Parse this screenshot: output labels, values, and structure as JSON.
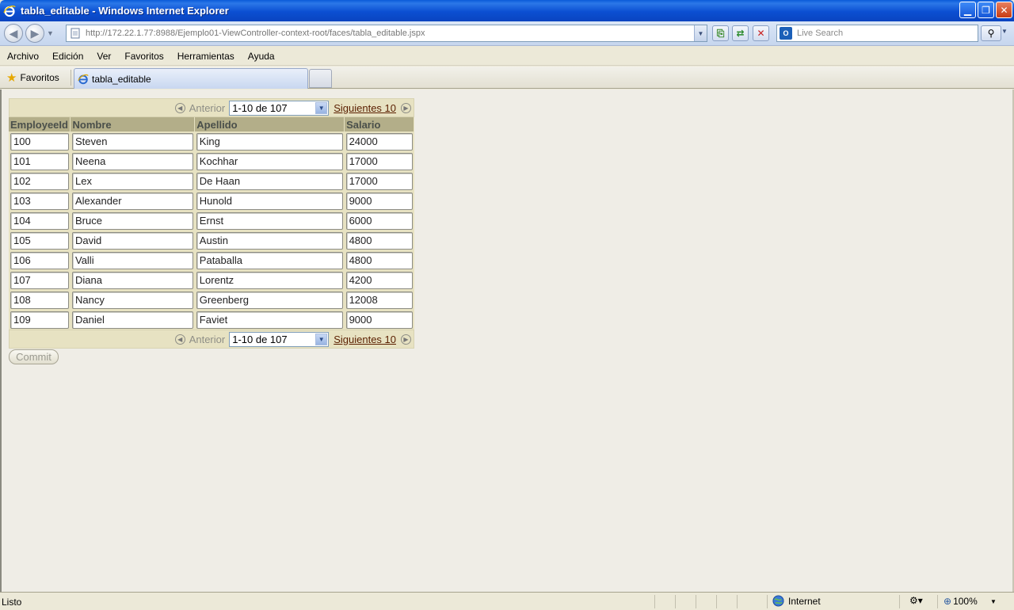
{
  "window": {
    "title": "tabla_editable - Windows Internet Explorer"
  },
  "navbar": {
    "url": "http://172.22.1.77:8988/Ejemplo01-ViewController-context-root/faces/tabla_editable.jspx",
    "search_placeholder": "Live Search",
    "live_icon_text": "O"
  },
  "menu": {
    "items": [
      "Archivo",
      "Edición",
      "Ver",
      "Favoritos",
      "Herramientas",
      "Ayuda"
    ]
  },
  "tabs": {
    "favorites_label": "Favoritos",
    "active_tab_label": "tabla_editable"
  },
  "pager": {
    "prev_label": "Anterior",
    "range_value": "1-10 de 107",
    "next_label": "Siguientes 10"
  },
  "table": {
    "headers": [
      "EmployeeId",
      "Nombre",
      "Apellido",
      "Salario"
    ],
    "rows": [
      [
        "100",
        "Steven",
        "King",
        "24000"
      ],
      [
        "101",
        "Neena",
        "Kochhar",
        "17000"
      ],
      [
        "102",
        "Lex",
        "De Haan",
        "17000"
      ],
      [
        "103",
        "Alexander",
        "Hunold",
        "9000"
      ],
      [
        "104",
        "Bruce",
        "Ernst",
        "6000"
      ],
      [
        "105",
        "David",
        "Austin",
        "4800"
      ],
      [
        "106",
        "Valli",
        "Pataballa",
        "4800"
      ],
      [
        "107",
        "Diana",
        "Lorentz",
        "4200"
      ],
      [
        "108",
        "Nancy",
        "Greenberg",
        "12008"
      ],
      [
        "109",
        "Daniel",
        "Faviet",
        "9000"
      ]
    ]
  },
  "commit_label": "Commit",
  "status": {
    "text": "Listo",
    "zone": "Internet",
    "zoom": "100%"
  },
  "icons": {
    "back": "back-arrow-icon",
    "forward": "forward-arrow-icon",
    "ie": "ie-logo-icon",
    "favorites": "star-icon",
    "globe": "globe-icon"
  },
  "colors": {
    "title_bar": "#0b4fd2",
    "table_header": "#b3ae89",
    "pager_band": "#e7e2c2",
    "link": "#5a1f00"
  }
}
